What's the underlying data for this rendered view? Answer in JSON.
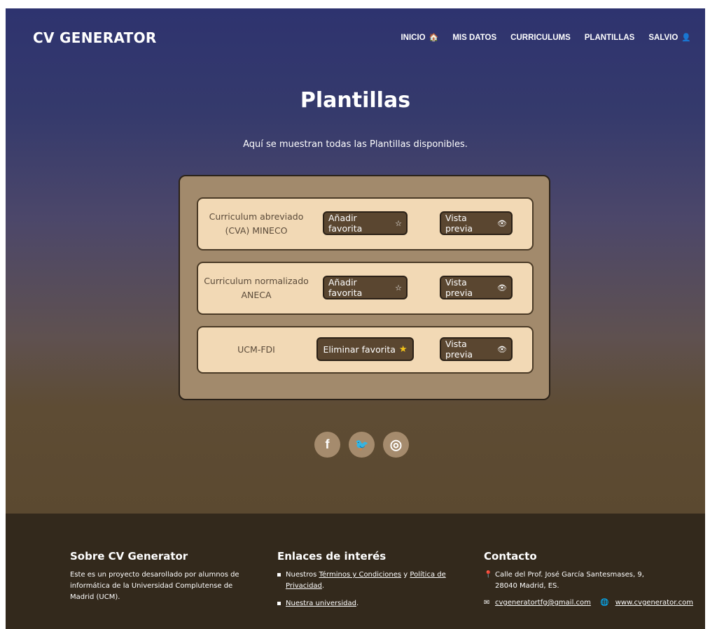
{
  "brand": "CV GENERATOR",
  "nav": {
    "items": [
      {
        "label": "INICIO",
        "icon": "home-icon",
        "glyph": "🏠"
      },
      {
        "label": "MIS DATOS"
      },
      {
        "label": "CURRICULUMS"
      },
      {
        "label": "PLANTILLAS"
      },
      {
        "label": "SALVIO",
        "icon": "user-icon",
        "glyph": "👤"
      }
    ]
  },
  "page": {
    "title": "Plantillas",
    "subtitle": "Aquí se muestran todas las Plantillas disponibles."
  },
  "templates": [
    {
      "name": "Curriculum abreviado (CVA) MINECO",
      "fav_label": "Añadir favorita",
      "fav_glyph": "☆",
      "preview_label": "Vista previa",
      "preview_glyph": "👁"
    },
    {
      "name": "Curriculum normalizado ANECA",
      "fav_label": "Añadir favorita",
      "fav_glyph": "☆",
      "preview_label": "Vista previa",
      "preview_glyph": "👁"
    },
    {
      "name": "UCM-FDI",
      "fav_label": "Eliminar favorita",
      "fav_glyph": "★",
      "preview_label": "Vista previa",
      "preview_glyph": "👁"
    }
  ],
  "social": {
    "facebook": "f",
    "twitter": "🐦",
    "instagram": "◎"
  },
  "footer": {
    "about": {
      "title": "Sobre CV Generator",
      "text": "Este es un proyecto desarollado por alumnos de informática de la Universidad Complutense de Madrid (UCM)."
    },
    "links": {
      "title": "Enlaces de interés",
      "item1_prefix": "Nuestros ",
      "item1_link1": "Términos y Condiciones",
      "item1_mid": " y ",
      "item1_link2": "Política de Privacidad",
      "item1_suffix": ".",
      "item2_link": "Nuestra universidad",
      "item2_suffix": "."
    },
    "contact": {
      "title": "Contacto",
      "address": "Calle del Prof. José García Santesmases, 9, 28040 Madrid, ES.",
      "email": "cvgeneratortfg@gmail.com",
      "web": "www.cvgenerator.com",
      "pin_glyph": "📍",
      "mail_glyph": "✉",
      "globe_glyph": "🌐"
    }
  },
  "colors": {
    "hero_top": "#2e336f",
    "hero_bottom": "#5b4930",
    "panel": "#a28a6c",
    "card": "#f2d9b5",
    "button": "#5a4630",
    "footer": "#33291c"
  }
}
